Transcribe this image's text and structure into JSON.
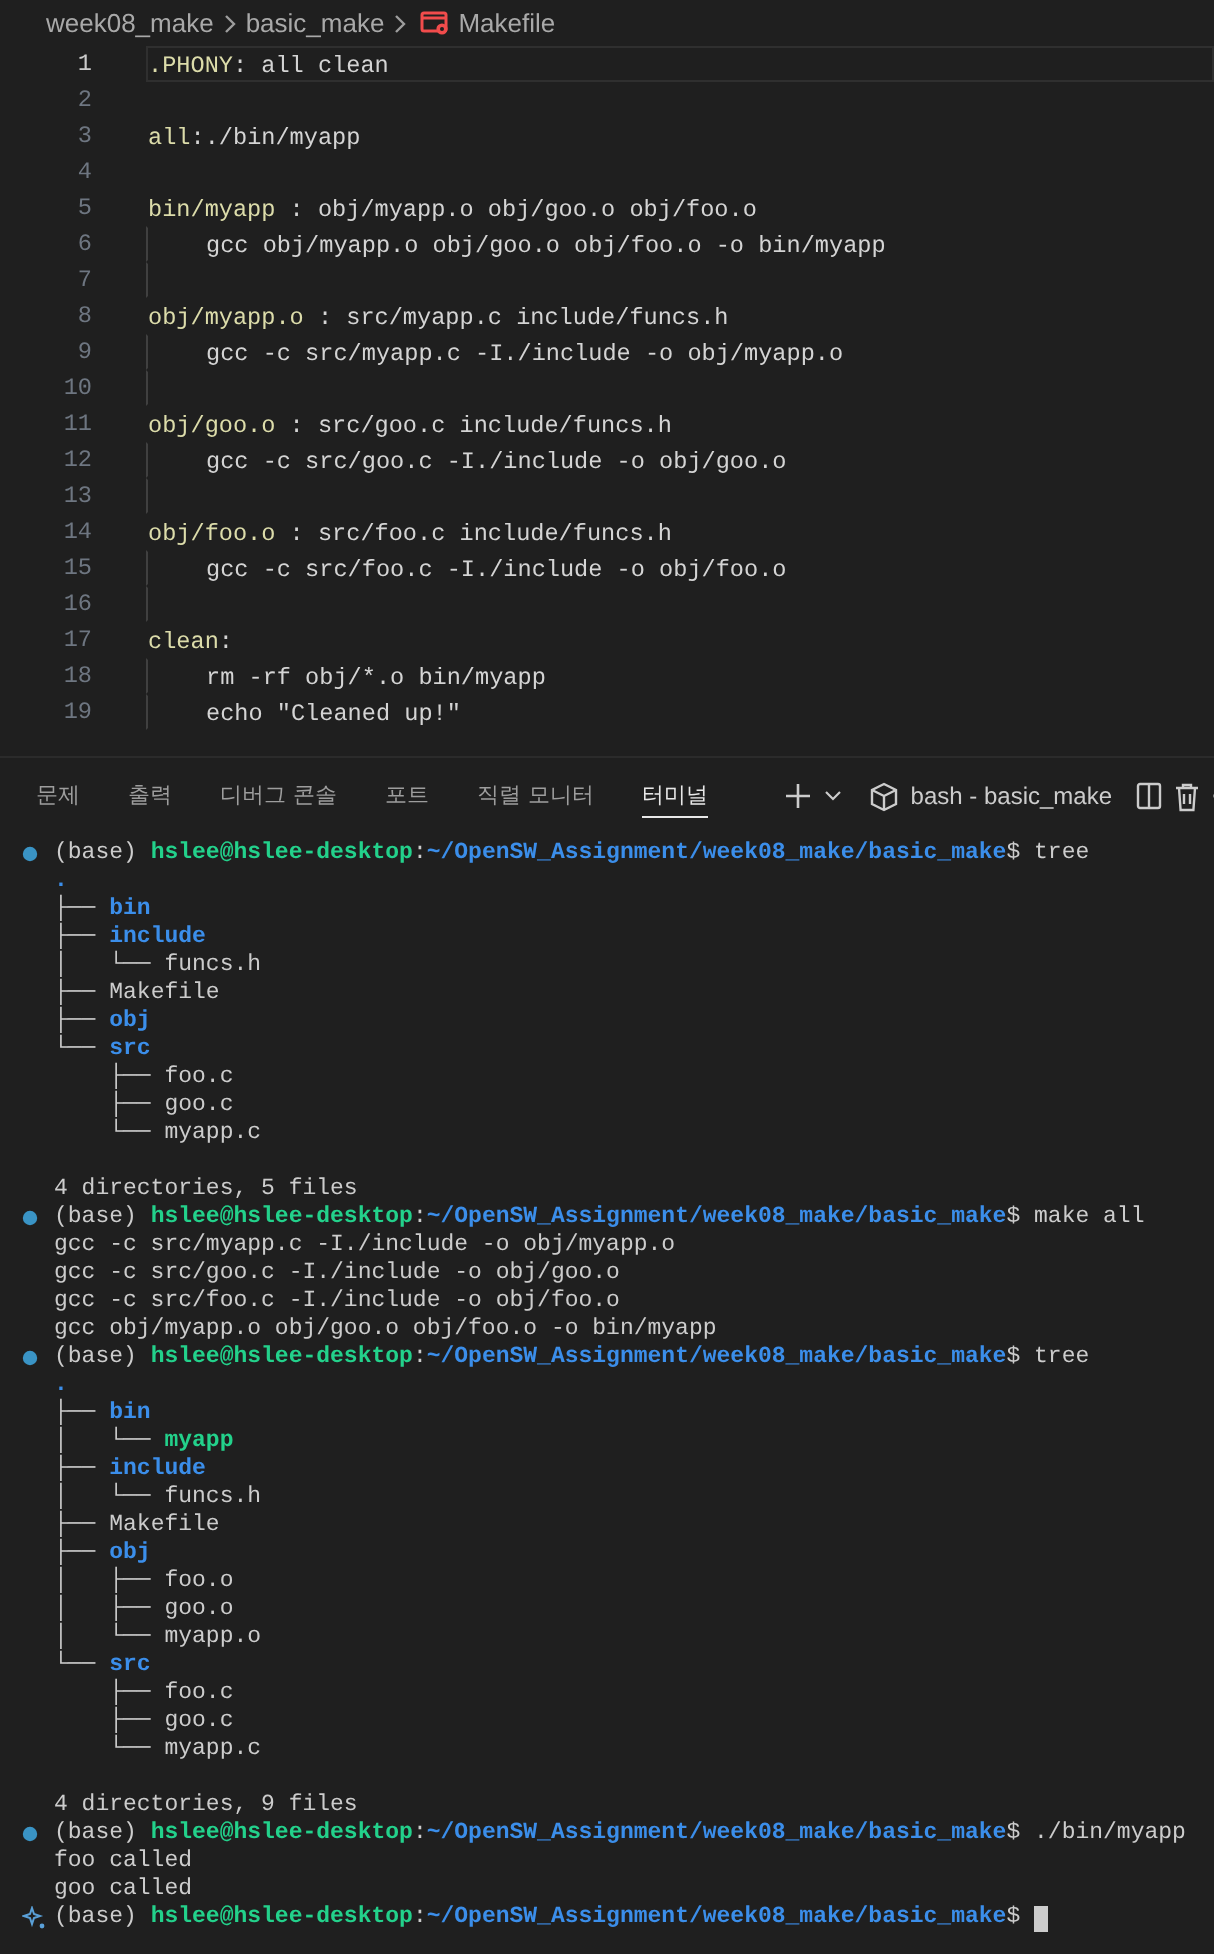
{
  "breadcrumb": [
    {
      "label": "week08_make",
      "kind": "folder"
    },
    {
      "label": "basic_make",
      "kind": "folder"
    },
    {
      "label": "Makefile",
      "kind": "makefile"
    }
  ],
  "editor": {
    "lines": [
      {
        "number": "1",
        "kind": "rule",
        "target": ".PHONY",
        "rest": ": all clean",
        "current": true
      },
      {
        "number": "2",
        "kind": "blank",
        "current": false
      },
      {
        "number": "3",
        "kind": "rule",
        "target": "all",
        "rest": ":./bin/myapp",
        "current": false
      },
      {
        "number": "4",
        "kind": "blank",
        "current": false
      },
      {
        "number": "5",
        "kind": "rule",
        "target": "bin/myapp",
        "rest": " : obj/myapp.o obj/goo.o obj/foo.o",
        "current": false
      },
      {
        "number": "6",
        "kind": "command",
        "text": "gcc obj/myapp.o obj/goo.o obj/foo.o -o bin/myapp",
        "current": false
      },
      {
        "number": "7",
        "kind": "blank",
        "current": false
      },
      {
        "number": "8",
        "kind": "rule",
        "target": "obj/myapp.o",
        "rest": " : src/myapp.c include/funcs.h",
        "current": false
      },
      {
        "number": "9",
        "kind": "command",
        "text": "gcc -c src/myapp.c -I./include -o obj/myapp.o",
        "current": false
      },
      {
        "number": "10",
        "kind": "blank",
        "current": false
      },
      {
        "number": "11",
        "kind": "rule",
        "target": "obj/goo.o",
        "rest": " : src/goo.c include/funcs.h",
        "current": false
      },
      {
        "number": "12",
        "kind": "command",
        "text": "gcc -c src/goo.c -I./include -o obj/goo.o",
        "current": false
      },
      {
        "number": "13",
        "kind": "blank",
        "current": false
      },
      {
        "number": "14",
        "kind": "rule",
        "target": "obj/foo.o",
        "rest": " : src/foo.c include/funcs.h",
        "current": false
      },
      {
        "number": "15",
        "kind": "command",
        "text": "gcc -c src/foo.c -I./include -o obj/foo.o",
        "current": false
      },
      {
        "number": "16",
        "kind": "blank",
        "current": false
      },
      {
        "number": "17",
        "kind": "rule",
        "target": "clean",
        "rest": ":",
        "current": false
      },
      {
        "number": "18",
        "kind": "command",
        "text": "rm -rf obj/*.o bin/myapp",
        "current": false
      },
      {
        "number": "19",
        "kind": "command",
        "text": "echo \"Cleaned up!\"",
        "current": false
      }
    ]
  },
  "panel": {
    "tabs": [
      {
        "label": "문제",
        "selected": false
      },
      {
        "label": "출력",
        "selected": false
      },
      {
        "label": "디버그 콘솔",
        "selected": false
      },
      {
        "label": "포트",
        "selected": false
      },
      {
        "label": "직렬 모니터",
        "selected": false
      },
      {
        "label": "터미널",
        "selected": true
      }
    ],
    "terminal_name": "bash - basic_make"
  },
  "terminal": {
    "lines": [
      {
        "kind": "prompt",
        "env": "(base)",
        "user": "hslee@hslee-desktop",
        "separator": ":",
        "path": "~/OpenSW_Assignment/week08_make/basic_make",
        "sigil": "$",
        "command": "tree",
        "active": false,
        "cursor": false
      },
      {
        "kind": "dir",
        "name": "."
      },
      {
        "kind": "dir",
        "prefix": "├── ",
        "name": "bin"
      },
      {
        "kind": "dir",
        "prefix": "├── ",
        "name": "include"
      },
      {
        "kind": "file",
        "prefix": "│   └── ",
        "name": "funcs.h"
      },
      {
        "kind": "file",
        "prefix": "├── ",
        "name": "Makefile"
      },
      {
        "kind": "dir",
        "prefix": "├── ",
        "name": "obj"
      },
      {
        "kind": "dir",
        "prefix": "└── ",
        "name": "src"
      },
      {
        "kind": "file",
        "prefix": "    ├── ",
        "name": "foo.c"
      },
      {
        "kind": "file",
        "prefix": "    ├── ",
        "name": "goo.c"
      },
      {
        "kind": "file",
        "prefix": "    └── ",
        "name": "myapp.c"
      },
      {
        "kind": "blank"
      },
      {
        "kind": "output",
        "text": "4 directories, 5 files"
      },
      {
        "kind": "prompt",
        "env": "(base)",
        "user": "hslee@hslee-desktop",
        "separator": ":",
        "path": "~/OpenSW_Assignment/week08_make/basic_make",
        "sigil": "$",
        "command": "make all",
        "active": false,
        "cursor": false
      },
      {
        "kind": "output",
        "text": "gcc -c src/myapp.c -I./include -o obj/myapp.o"
      },
      {
        "kind": "output",
        "text": "gcc -c src/goo.c -I./include -o obj/goo.o"
      },
      {
        "kind": "output",
        "text": "gcc -c src/foo.c -I./include -o obj/foo.o"
      },
      {
        "kind": "output",
        "text": "gcc obj/myapp.o obj/goo.o obj/foo.o -o bin/myapp"
      },
      {
        "kind": "prompt",
        "env": "(base)",
        "user": "hslee@hslee-desktop",
        "separator": ":",
        "path": "~/OpenSW_Assignment/week08_make/basic_make",
        "sigil": "$",
        "command": "tree",
        "active": false,
        "cursor": false
      },
      {
        "kind": "dir",
        "name": "."
      },
      {
        "kind": "dir",
        "prefix": "├── ",
        "name": "bin"
      },
      {
        "kind": "exe",
        "prefix": "│   └── ",
        "name": "myapp"
      },
      {
        "kind": "dir",
        "prefix": "├── ",
        "name": "include"
      },
      {
        "kind": "file",
        "prefix": "│   └── ",
        "name": "funcs.h"
      },
      {
        "kind": "file",
        "prefix": "├── ",
        "name": "Makefile"
      },
      {
        "kind": "dir",
        "prefix": "├── ",
        "name": "obj"
      },
      {
        "kind": "file",
        "prefix": "│   ├── ",
        "name": "foo.o"
      },
      {
        "kind": "file",
        "prefix": "│   ├── ",
        "name": "goo.o"
      },
      {
        "kind": "file",
        "prefix": "│   └── ",
        "name": "myapp.o"
      },
      {
        "kind": "dir",
        "prefix": "└── ",
        "name": "src"
      },
      {
        "kind": "file",
        "prefix": "    ├── ",
        "name": "foo.c"
      },
      {
        "kind": "file",
        "prefix": "    ├── ",
        "name": "goo.c"
      },
      {
        "kind": "file",
        "prefix": "    └── ",
        "name": "myapp.c"
      },
      {
        "kind": "blank"
      },
      {
        "kind": "output",
        "text": "4 directories, 9 files"
      },
      {
        "kind": "prompt",
        "env": "(base)",
        "user": "hslee@hslee-desktop",
        "separator": ":",
        "path": "~/OpenSW_Assignment/week08_make/basic_make",
        "sigil": "$",
        "command": "./bin/myapp",
        "active": false,
        "cursor": false
      },
      {
        "kind": "output",
        "text": "foo called"
      },
      {
        "kind": "output",
        "text": "goo called"
      },
      {
        "kind": "prompt",
        "env": "(base)",
        "user": "hslee@hslee-desktop",
        "separator": ":",
        "path": "~/OpenSW_Assignment/week08_make/basic_make",
        "sigil": "$",
        "active": true,
        "cursor": true
      }
    ]
  }
}
